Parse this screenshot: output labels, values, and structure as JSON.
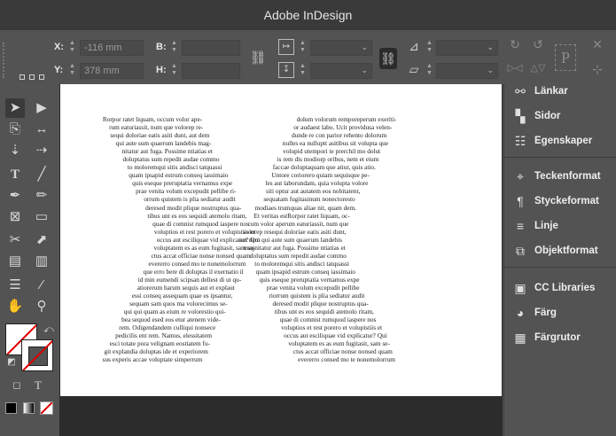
{
  "app": {
    "title": "Adobe InDesign"
  },
  "control_bar": {
    "x_label": "X:",
    "x_value": "-116 mm",
    "y_label": "Y:",
    "y_value": "378 mm",
    "b_label": "B:",
    "b_value": "",
    "h_label": "H:",
    "h_value": ""
  },
  "panels": [
    {
      "label": "Länkar",
      "icon": "links-icon"
    },
    {
      "label": "Sidor",
      "icon": "pages-icon"
    },
    {
      "label": "Egenskaper",
      "icon": "properties-icon"
    },
    {
      "label": "Teckenformat",
      "icon": "character-styles-icon"
    },
    {
      "label": "Styckeformat",
      "icon": "paragraph-styles-icon"
    },
    {
      "label": "Linje",
      "icon": "stroke-icon"
    },
    {
      "label": "Objektformat",
      "icon": "object-styles-icon"
    },
    {
      "label": "CC Libraries",
      "icon": "cc-libraries-icon"
    },
    {
      "label": "Färg",
      "icon": "color-icon"
    },
    {
      "label": "Färgrutor",
      "icon": "swatches-icon"
    }
  ],
  "document": {
    "left_lines": [
      "Rorpor ratet liquam, occum volor ape-",
      "rum eaturiassit, num que volorep re-",
      "sequi doloriae eatis asiti dunt, aut dem",
      "qui aute sum quaerum landebis mag-",
      "nitatur aut fuga. Possime ntiatias et",
      "doluptatus sum repedit audae commo",
      "to moloremqui sitis andisci tatquassi",
      "quam ipsapid estrum conseq iassimaio",
      "quis eseque preruptatia vernamus expe",
      "prae venita volum excepudit pellibe ri-",
      "orrum quistem is plia sediatur audit",
      "deresed modit plique nostruptus qua-",
      "tibus unt es eos sequidi atemolo ritam,",
      "quae di comnist rumquod iaspere nos",
      "voluptios et rest porero et volupistiis et",
      "occus aut esciliquae vid explicatur? Qui",
      "voluptatem es as eum fugitasit, sam se-",
      "ctus accat officiae nonse nonsed quam",
      "evererro consed mo te nonemolorrum",
      "que erro bere di doluptas il exernatio il",
      "id min eumendi scipsan dellest di ut qu-",
      "atiorerum harum sequis aut et explaut",
      "essi conseq assequam quae es ipsantur,",
      "sequam sam quos ma volorecimus se-",
      "qui qui quam as eium re volorestio qui-",
      "bea sequod esed eos etur atenem vide-",
      "rem. Odigendandem culliqui nonsece",
      "pedicilis ent rem. Namus, elessitatem",
      "esci totate pora velignam eostiatem fu-",
      "git explandia doluptas ide et experiorem",
      "sus experis accae voluptate simperrum"
    ],
    "right_lines": [
      "dolum volorum remporeperum exeriti-",
      "or audaest labo. Ucit providusa velen-",
      "dunde re con parior rehento dolorum",
      "nulles ea nulluptt asitibus sit volupta que",
      "volupid utempori te prerchil mo dolut",
      "is rem dis modiorp oribus, nem et eium",
      "faccae doluptaquam que atiur, quis atio.",
      "Untore coriorero quiam sequisque pe-",
      "les aut laborundam, quia volupta volore",
      "siti optur aut autatem eos nobitatent,",
      "sequatam fugitasinum nonectoresto",
      "modiaes trumquas aliae nit, quam dem.",
      "Et veritas estRorpor ratet liquam, oc-",
      "cum volor aperum eaturiassit, num que",
      "volorep resequi doloriae eatis asiti dunt,",
      "aut dem qui aute sum quaerum landebis",
      "magnitatur aut fuga. Possime ntiatias et",
      "doluptatus sum repedit audae commo",
      "to moloremqui sitis andisci tatquassi",
      "quam ipsapid estrum conseq iassimaio",
      "quis eseque preruptatia vernamus expe",
      "prae venita volum excepudit pellibe",
      "riorrum quistem is plia sediatur audit",
      "deresed modit plique nostruptus qua-",
      "tibus unt es eos sequidi atemolo ritam,",
      "quae di comnist rumquod iaspere nos",
      "voluptios et rest porero et volupistiis et",
      "occus aut esciliquae vid explicatur? Qui",
      "voluptatem es as eum fugitasit, sam se-",
      "ctus accat officiae nonse nonsed quam",
      "evererro consed mo te nonemolorrum"
    ]
  }
}
